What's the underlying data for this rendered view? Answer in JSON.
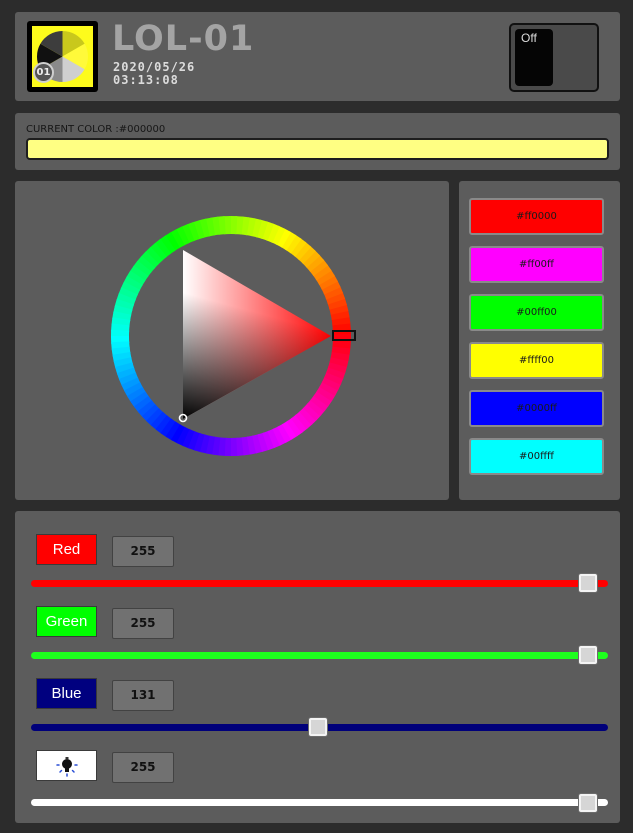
{
  "header": {
    "logo_badge": "01",
    "device_name": "LOL-01",
    "date": "2020/05/26",
    "time": "03:13:08",
    "power_label": "Off"
  },
  "current_color": {
    "label": "CURRENT COLOR :#000000",
    "swatch_color": "#ffff83"
  },
  "wheel": {
    "hue_degrees": 0,
    "selected_color": "#000000"
  },
  "presets": [
    {
      "label": "#ff0000",
      "color": "#ff0000"
    },
    {
      "label": "#ff00ff",
      "color": "#ff00ff"
    },
    {
      "label": "#00ff00",
      "color": "#00ff00"
    },
    {
      "label": "#ffff00",
      "color": "#ffff00"
    },
    {
      "label": "#0000ff",
      "color": "#0000ff"
    },
    {
      "label": "#00ffff",
      "color": "#00ffff"
    }
  ],
  "sliders": [
    {
      "name": "red",
      "label": "Red",
      "value": "255",
      "level": 255,
      "max": 255,
      "chip_color": "#ff0000",
      "track_color": "#ff0000"
    },
    {
      "name": "green",
      "label": "Green",
      "value": "255",
      "level": 255,
      "max": 255,
      "chip_color": "#00ff00",
      "track_color": "#1eff1e"
    },
    {
      "name": "blue",
      "label": "Blue",
      "value": "131",
      "level": 131,
      "max": 255,
      "chip_color": "#00007f",
      "track_color": "#00007a"
    },
    {
      "name": "brightness",
      "label": "",
      "icon": "bulb-icon",
      "value": "255",
      "level": 255,
      "max": 255,
      "chip_color": "#ffffff",
      "track_color": "#ffffff"
    }
  ]
}
